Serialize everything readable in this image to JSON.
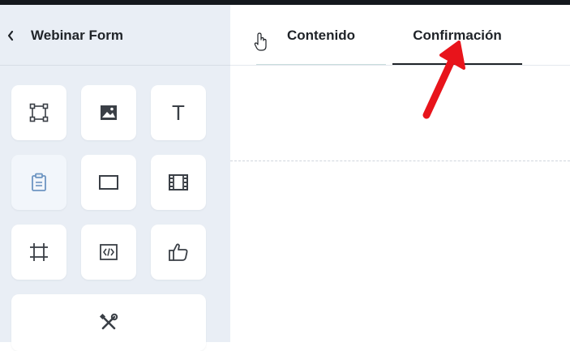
{
  "sidebar": {
    "title": "Webinar Form",
    "tools": [
      {
        "icon": "frame-select-icon"
      },
      {
        "icon": "image-icon"
      },
      {
        "icon": "text-icon",
        "glyph": "T"
      },
      {
        "icon": "clipboard-icon",
        "active": true
      },
      {
        "icon": "rectangle-icon"
      },
      {
        "icon": "film-icon"
      },
      {
        "icon": "crop-frame-icon"
      },
      {
        "icon": "code-icon"
      },
      {
        "icon": "thumbs-up-icon"
      },
      {
        "icon": "tools-icon"
      }
    ]
  },
  "tabs": {
    "contenido": "Contenido",
    "confirmacion": "Confirmación",
    "active": "Confirmación"
  },
  "colors": {
    "sidebar_bg": "#e9eef5",
    "annotation_arrow": "#e8141b",
    "active_tile_icon": "#6d95c2"
  }
}
